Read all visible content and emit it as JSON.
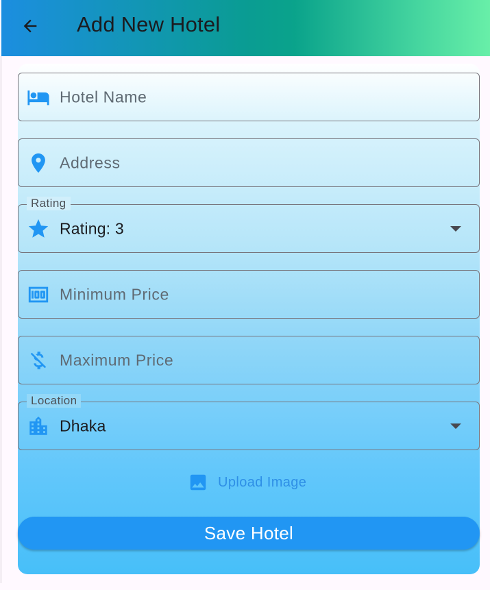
{
  "appbar": {
    "title": "Add New Hotel",
    "back_icon": "arrow-back-icon"
  },
  "form": {
    "hotel_name": {
      "placeholder": "Hotel Name",
      "icon": "hotel-bed-icon"
    },
    "address": {
      "placeholder": "Address",
      "icon": "location-pin-icon"
    },
    "rating": {
      "label": "Rating",
      "value": "Rating: 3",
      "icon": "star-icon"
    },
    "min_price": {
      "placeholder": "Minimum Price",
      "icon": "money-icon"
    },
    "max_price": {
      "placeholder": "Maximum Price",
      "icon": "money-off-icon"
    },
    "location": {
      "label": "Location",
      "value": "Dhaka",
      "icon": "location-city-icon"
    },
    "upload": {
      "label": "Upload Image",
      "icon": "image-icon"
    },
    "save_label": "Save Hotel"
  },
  "colors": {
    "accent": "#2196f3",
    "icon": "#2196f3",
    "outline": "#77757d",
    "appbar_gradient_start": "#1c8ee0",
    "appbar_gradient_mid": "#0a9c93",
    "appbar_gradient_end": "#68efa8"
  }
}
